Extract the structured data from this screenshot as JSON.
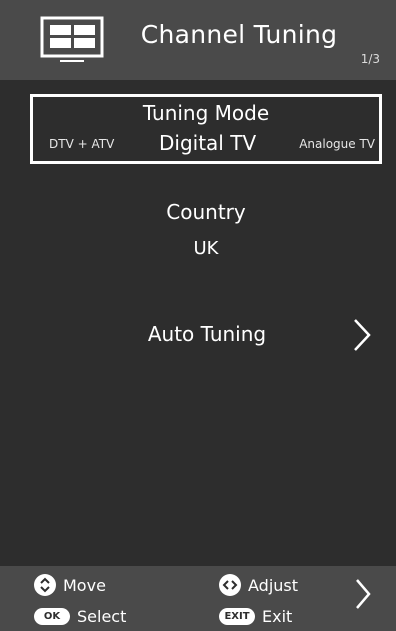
{
  "header": {
    "title": "Channel Tuning",
    "page_indicator": "1/3",
    "icon": "tv-icon"
  },
  "tuning_mode": {
    "label": "Tuning Mode",
    "options": [
      "DTV + ATV",
      "Digital TV",
      "Analogue TV"
    ],
    "selected": "Digital TV"
  },
  "country": {
    "label": "Country",
    "value": "UK"
  },
  "auto_tuning": {
    "label": "Auto Tuning",
    "icon": "chevron-right-icon"
  },
  "footer": {
    "move": {
      "icon": "up-down-icon",
      "label": "Move"
    },
    "adjust": {
      "icon": "left-right-icon",
      "label": "Adjust"
    },
    "select": {
      "icon_text": "OK",
      "label": "Select"
    },
    "exit": {
      "icon_text": "EXIT",
      "label": "Exit"
    },
    "next_icon": "chevron-right-icon"
  },
  "colors": {
    "background": "#2d2d2d",
    "bar": "#4a4a4a",
    "text": "#ffffff"
  }
}
